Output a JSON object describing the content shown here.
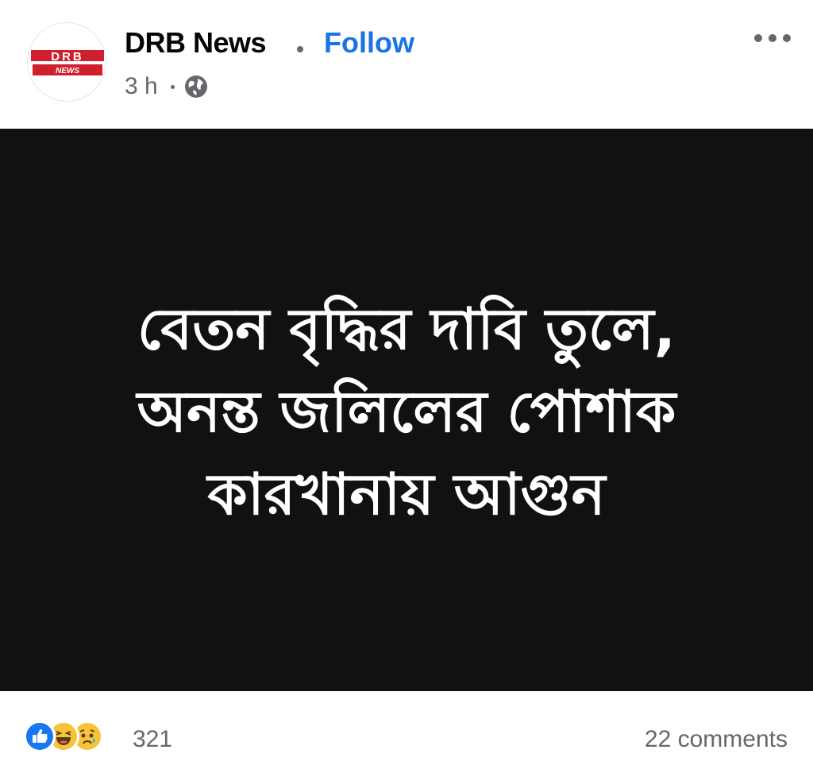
{
  "post": {
    "page_name": "DRB News",
    "follow_label": "Follow",
    "time": "3 h",
    "privacy_icon": "globe-icon",
    "avatar_logo_text": "DRB",
    "avatar_logo_subtext": "NEWS"
  },
  "media": {
    "headline_lines": [
      "বেতন বৃদ্ধির দাবি তুলে,",
      "অনন্ত জলিলের পোশাক",
      "কারখানায় আগুন"
    ]
  },
  "footer": {
    "reaction_icons": [
      "like-icon",
      "haha-icon",
      "sad-icon"
    ],
    "reaction_count": "321",
    "comments_label": "22 comments"
  },
  "colors": {
    "accent": "#1b74e4",
    "secondary_text": "#65676b",
    "media_background": "#111111",
    "logo_red": "#d0202f"
  }
}
